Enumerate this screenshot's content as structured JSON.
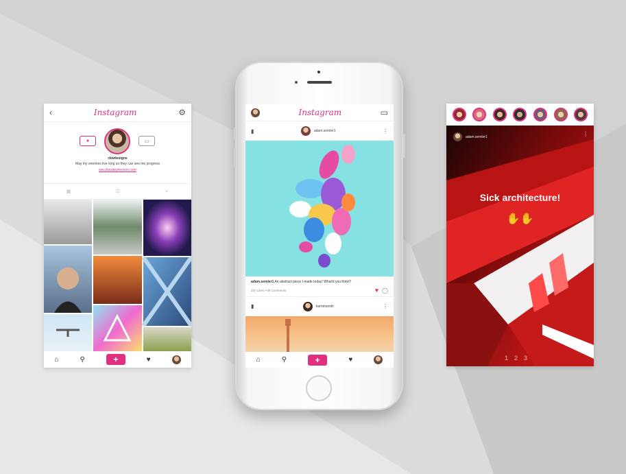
{
  "left_profile": {
    "brand": "Instagram",
    "back_icon": "chevron-left-icon",
    "settings_icon": "gear-icon",
    "username": "ckwdesigns",
    "bio": "May my enemies live long so they can see me progress",
    "link": "ww.ckwsitephenson.com",
    "tabs": [
      "grid-icon",
      "list-icon",
      "tag-icon"
    ],
    "nav_icons": [
      "home-icon",
      "search-icon",
      "plus-icon",
      "heart-icon",
      "avatar"
    ],
    "plus_label": "+"
  },
  "phone_feed": {
    "brand": "Instagram",
    "inbox_icon": "inbox-icon",
    "post1": {
      "username": "adam.semler1",
      "caption_user": "adam.semler1",
      "caption_text": " An abstract piece I made today! What'd you think?",
      "likes": "257 Likes",
      "dot": "•",
      "comments": "69 Comments"
    },
    "post2": {
      "username": "harrietsmith"
    },
    "nav_icons": [
      "home-icon",
      "search-icon",
      "plus-icon",
      "heart-icon",
      "avatar"
    ],
    "plus_label": "+"
  },
  "right_story": {
    "story_count": 7,
    "username": "adam.semler1",
    "title": "Sick architecture!",
    "emoji_icon": "raised-hands-icon",
    "pages": [
      "1",
      "2",
      "3"
    ]
  },
  "colors": {
    "accent": "#e0307f",
    "background_light": "#e6e6e6",
    "background_dark": "#c6c6c6"
  }
}
